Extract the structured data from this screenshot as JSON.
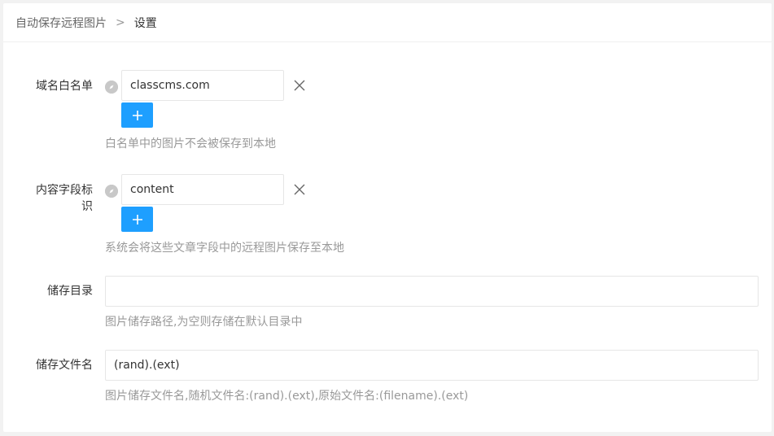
{
  "breadcrumb": {
    "parent": "自动保存远程图片",
    "separator": ">",
    "current": "设置"
  },
  "fields": {
    "whitelist": {
      "label": "域名白名单",
      "value": "classcms.com",
      "tip": "白名单中的图片不会被保存到本地"
    },
    "content_field": {
      "label_line1": "内容字段标",
      "label_line2": "识",
      "value": "content",
      "tip": "系统会将这些文章字段中的远程图片保存至本地"
    },
    "storage_dir": {
      "label": "储存目录",
      "value": "",
      "tip": "图片储存路径,为空则存储在默认目录中"
    },
    "storage_filename": {
      "label": "储存文件名",
      "value": "(rand).(ext)",
      "tip": "图片储存文件名,随机文件名:(rand).(ext),原始文件名:(filename).(ext)"
    }
  },
  "colors": {
    "accent": "#1e9fff",
    "hint_icon": "#c8c8c8"
  }
}
